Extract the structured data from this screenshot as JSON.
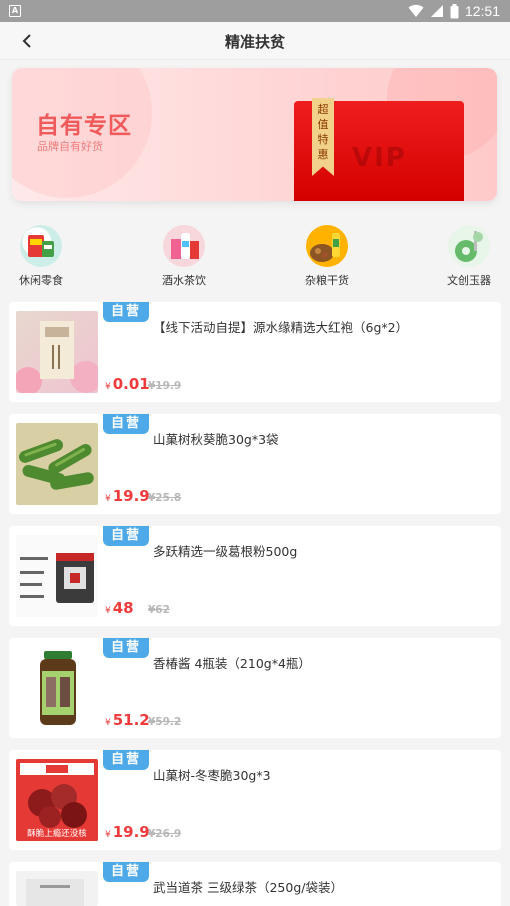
{
  "status_bar": {
    "time": "12:51",
    "left_icon": "A"
  },
  "nav": {
    "title": "精准扶贫"
  },
  "banner": {
    "title": "自有专区",
    "subtitle": "品牌自有好货",
    "ribbon": "超\n值\n特\n惠",
    "vip_text": "VIP"
  },
  "categories": [
    {
      "label": "休闲零食",
      "icon": "snack-icon"
    },
    {
      "label": "酒水茶饮",
      "icon": "drinks-icon"
    },
    {
      "label": "杂粮干货",
      "icon": "grains-icon"
    },
    {
      "label": "文创玉器",
      "icon": "jade-icon"
    }
  ],
  "tag_label": "自营",
  "currency": "¥",
  "products": [
    {
      "name": "【线下活动自提】源水缘精选大红袍（6g*2）",
      "price": "0.01",
      "original_price": "¥19.9",
      "thumb_text": ""
    },
    {
      "name": "山菓树秋葵脆30g*3袋",
      "price": "19.9",
      "original_price": "¥25.8",
      "thumb_text": ""
    },
    {
      "name": "多跃精选一级葛根粉500g",
      "price": "48",
      "original_price": "¥62",
      "thumb_text": ""
    },
    {
      "name": "香椿酱 4瓶装（210g*4瓶）",
      "price": "51.2",
      "original_price": "¥59.2",
      "thumb_text": ""
    },
    {
      "name": "山菓树-冬枣脆30g*3",
      "price": "19.9",
      "original_price": "¥26.9",
      "thumb_text": "酥脆上瘾还没核"
    },
    {
      "name": "武当道茶 三级绿茶（250g/袋装）",
      "price": "",
      "original_price": "",
      "thumb_text": ""
    }
  ],
  "colors": {
    "accent_red": "#ef3b3b",
    "tag_blue": "#4ea9e8",
    "banner_pink": "#ffd6d6"
  }
}
